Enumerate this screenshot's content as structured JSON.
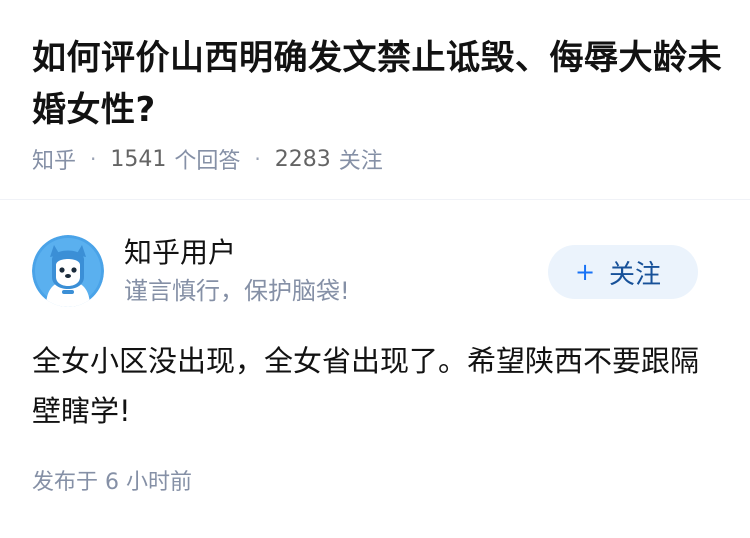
{
  "question": {
    "title": "如何评价山西明确发文禁止诋毁、侮辱大龄未婚女性?",
    "source": "知乎",
    "answer_count": "1541",
    "answer_unit": "个回答",
    "follower_count": "2283",
    "follower_unit": "关注",
    "separator": "·"
  },
  "answer": {
    "author": {
      "name": "知乎用户",
      "bio": "谨言慎行，保护脑袋!",
      "avatar_icon": "default-user-avatar-icon"
    },
    "follow_button": {
      "plus": "+",
      "label": "关注"
    },
    "content": "全女小区没出现，全女省出现了。希望陕西不要跟隔壁瞎学!",
    "time": "发布于  6 小时前"
  },
  "colors": {
    "title": "#121212",
    "meta": "#8590a6",
    "follow_bg": "#ebf3fc",
    "follow_text": "#175199",
    "avatar_blue": "#4aa3e8"
  }
}
